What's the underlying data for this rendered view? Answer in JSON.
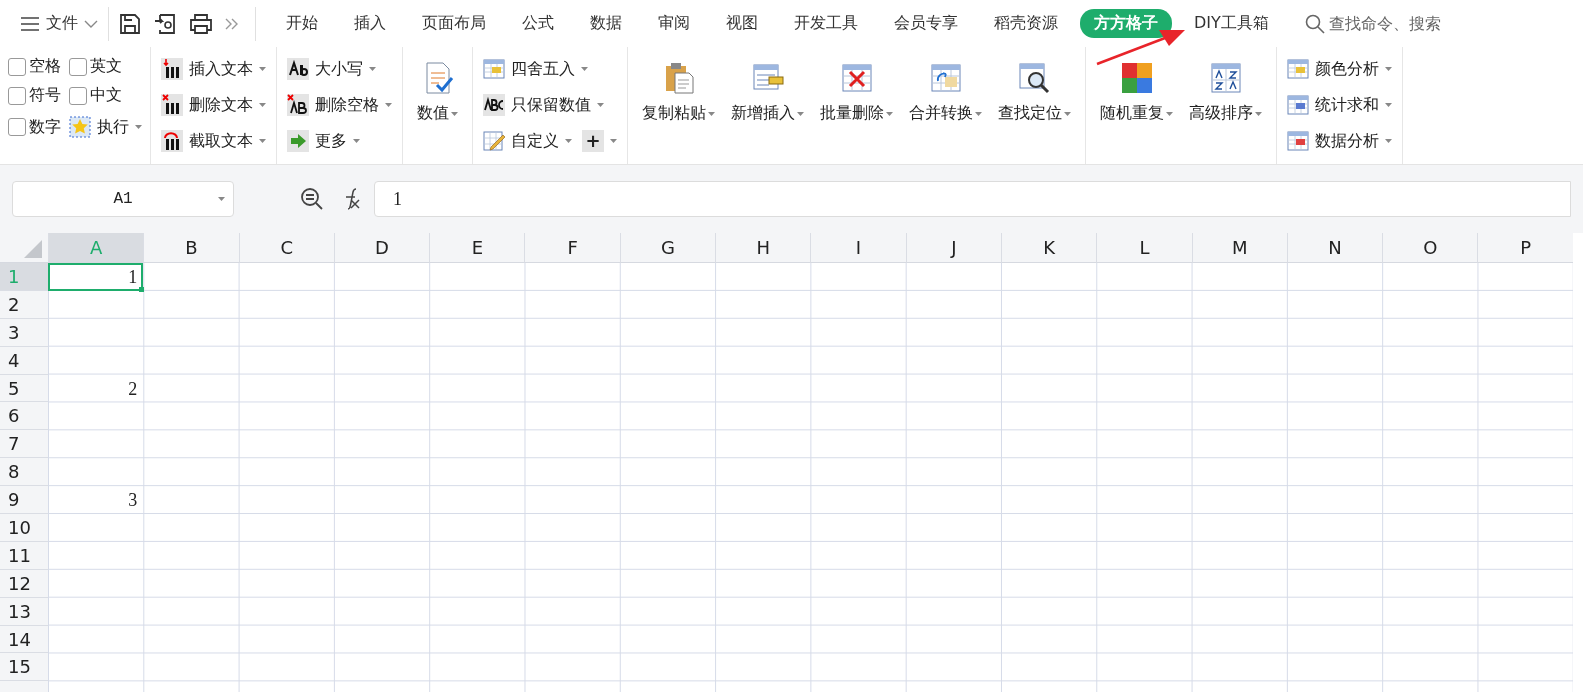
{
  "menu": {
    "label": "文件"
  },
  "tabs": [
    {
      "label": "开始",
      "selected": false
    },
    {
      "label": "插入",
      "selected": false
    },
    {
      "label": "页面布局",
      "selected": false
    },
    {
      "label": "公式",
      "selected": false
    },
    {
      "label": "数据",
      "selected": false
    },
    {
      "label": "审阅",
      "selected": false
    },
    {
      "label": "视图",
      "selected": false
    },
    {
      "label": "开发工具",
      "selected": false
    },
    {
      "label": "会员专享",
      "selected": false
    },
    {
      "label": "稻壳资源",
      "selected": false
    },
    {
      "label": "方方格子",
      "selected": true
    },
    {
      "label": "DIY工具箱",
      "selected": false
    }
  ],
  "search": {
    "placeholder": "查找命令、搜索"
  },
  "ribbon": [
    {
      "kind": "checks",
      "checks": [
        {
          "label": "空格",
          "checked": false
        },
        {
          "label": "英文",
          "checked": false
        },
        {
          "label": "符号",
          "checked": false
        },
        {
          "label": "中文",
          "checked": false
        },
        {
          "label": "数字",
          "checked": false
        }
      ],
      "extra": {
        "label": "执行",
        "dropdown": true
      }
    },
    {
      "kind": "small",
      "items": [
        {
          "label": "插入文本",
          "dropdown": true
        },
        {
          "label": "删除文本",
          "dropdown": true
        },
        {
          "label": "截取文本",
          "dropdown": true
        }
      ]
    },
    {
      "kind": "small",
      "items": [
        {
          "label": "大小写",
          "dropdown": true
        },
        {
          "label": "删除空格",
          "dropdown": true
        },
        {
          "label": "更多",
          "dropdown": true
        }
      ]
    },
    {
      "kind": "large",
      "items": [
        {
          "label": "数值",
          "dropdown": true
        }
      ]
    },
    {
      "kind": "small",
      "items": [
        {
          "label": "四舍五入",
          "dropdown": true
        },
        {
          "label": "只保留数值",
          "dropdown": true
        },
        {
          "label": "自定义",
          "dropdown": true
        }
      ],
      "extra": {
        "label": "+",
        "dropdown": true
      }
    },
    {
      "kind": "large",
      "items": [
        {
          "label": "复制粘贴",
          "dropdown": true
        },
        {
          "label": "新增插入",
          "dropdown": true
        },
        {
          "label": "批量删除",
          "dropdown": true
        },
        {
          "label": "合并转换",
          "dropdown": true
        },
        {
          "label": "查找定位",
          "dropdown": true
        }
      ]
    },
    {
      "kind": "large",
      "items": [
        {
          "label": "随机重复",
          "dropdown": true
        },
        {
          "label": "高级排序",
          "dropdown": true
        }
      ]
    },
    {
      "kind": "small",
      "items": [
        {
          "label": "颜色分析",
          "dropdown": true
        },
        {
          "label": "统计求和",
          "dropdown": true
        },
        {
          "label": "数据分析",
          "dropdown": true
        }
      ]
    }
  ],
  "formula_bar": {
    "name_box": "A1",
    "formula": "1"
  },
  "sheet": {
    "columns": [
      {
        "label": "A",
        "selected": true
      },
      {
        "label": "B",
        "selected": false
      },
      {
        "label": "C",
        "selected": false
      },
      {
        "label": "D",
        "selected": false
      },
      {
        "label": "E",
        "selected": false
      },
      {
        "label": "F",
        "selected": false
      },
      {
        "label": "G",
        "selected": false
      },
      {
        "label": "H",
        "selected": false
      },
      {
        "label": "I",
        "selected": false
      },
      {
        "label": "J",
        "selected": false
      },
      {
        "label": "K",
        "selected": false
      },
      {
        "label": "L",
        "selected": false
      },
      {
        "label": "M",
        "selected": false
      },
      {
        "label": "N",
        "selected": false
      },
      {
        "label": "O",
        "selected": false
      },
      {
        "label": "P",
        "selected": false
      }
    ],
    "rows": [
      {
        "label": "1",
        "selected": true,
        "value": "1"
      },
      {
        "label": "2",
        "selected": false
      },
      {
        "label": "3",
        "selected": false
      },
      {
        "label": "4",
        "selected": false
      },
      {
        "label": "5",
        "selected": false,
        "value": "2"
      },
      {
        "label": "6",
        "selected": false
      },
      {
        "label": "7",
        "selected": false
      },
      {
        "label": "8",
        "selected": false
      },
      {
        "label": "9",
        "selected": false,
        "value": "3"
      },
      {
        "label": "10",
        "selected": false
      },
      {
        "label": "11",
        "selected": false
      },
      {
        "label": "12",
        "selected": false
      },
      {
        "label": "13",
        "selected": false
      },
      {
        "label": "14",
        "selected": false
      },
      {
        "label": "15",
        "selected": false
      }
    ]
  }
}
